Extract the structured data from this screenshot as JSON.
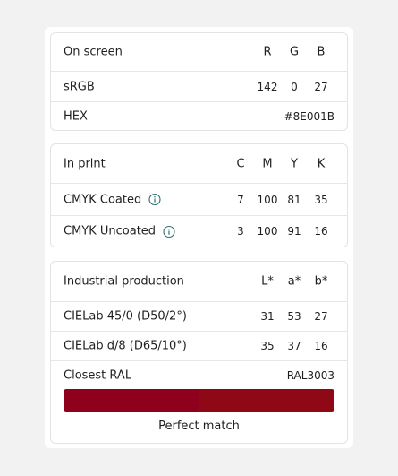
{
  "on_screen": {
    "title": "On screen",
    "columns": [
      "R",
      "G",
      "B"
    ],
    "srgb": {
      "label": "sRGB",
      "values": [
        "142",
        "0",
        "27"
      ]
    },
    "hex": {
      "label": "HEX",
      "value": "#8E001B"
    }
  },
  "in_print": {
    "title": "In print",
    "columns": [
      "C",
      "M",
      "Y",
      "K"
    ],
    "coated": {
      "label": "CMYK Coated",
      "values": [
        "7",
        "100",
        "81",
        "35"
      ]
    },
    "uncoated": {
      "label": "CMYK Uncoated",
      "values": [
        "3",
        "100",
        "91",
        "16"
      ]
    }
  },
  "industrial": {
    "title": "Industrial production",
    "columns": [
      "L*",
      "a*",
      "b*"
    ],
    "cielab1": {
      "label": "CIELab 45/0 (D50/2°)",
      "values": [
        "31",
        "53",
        "27"
      ]
    },
    "cielab2": {
      "label": "CIELab d/8 (D65/10°)",
      "values": [
        "35",
        "37",
        "16"
      ]
    },
    "ral": {
      "label": "Closest RAL",
      "value": "RAL3003"
    },
    "match_text": "Perfect match"
  },
  "colors": {
    "swatch_target": "#8E001B",
    "swatch_ral": "#8E0915",
    "info_icon": "#2f6f73"
  }
}
